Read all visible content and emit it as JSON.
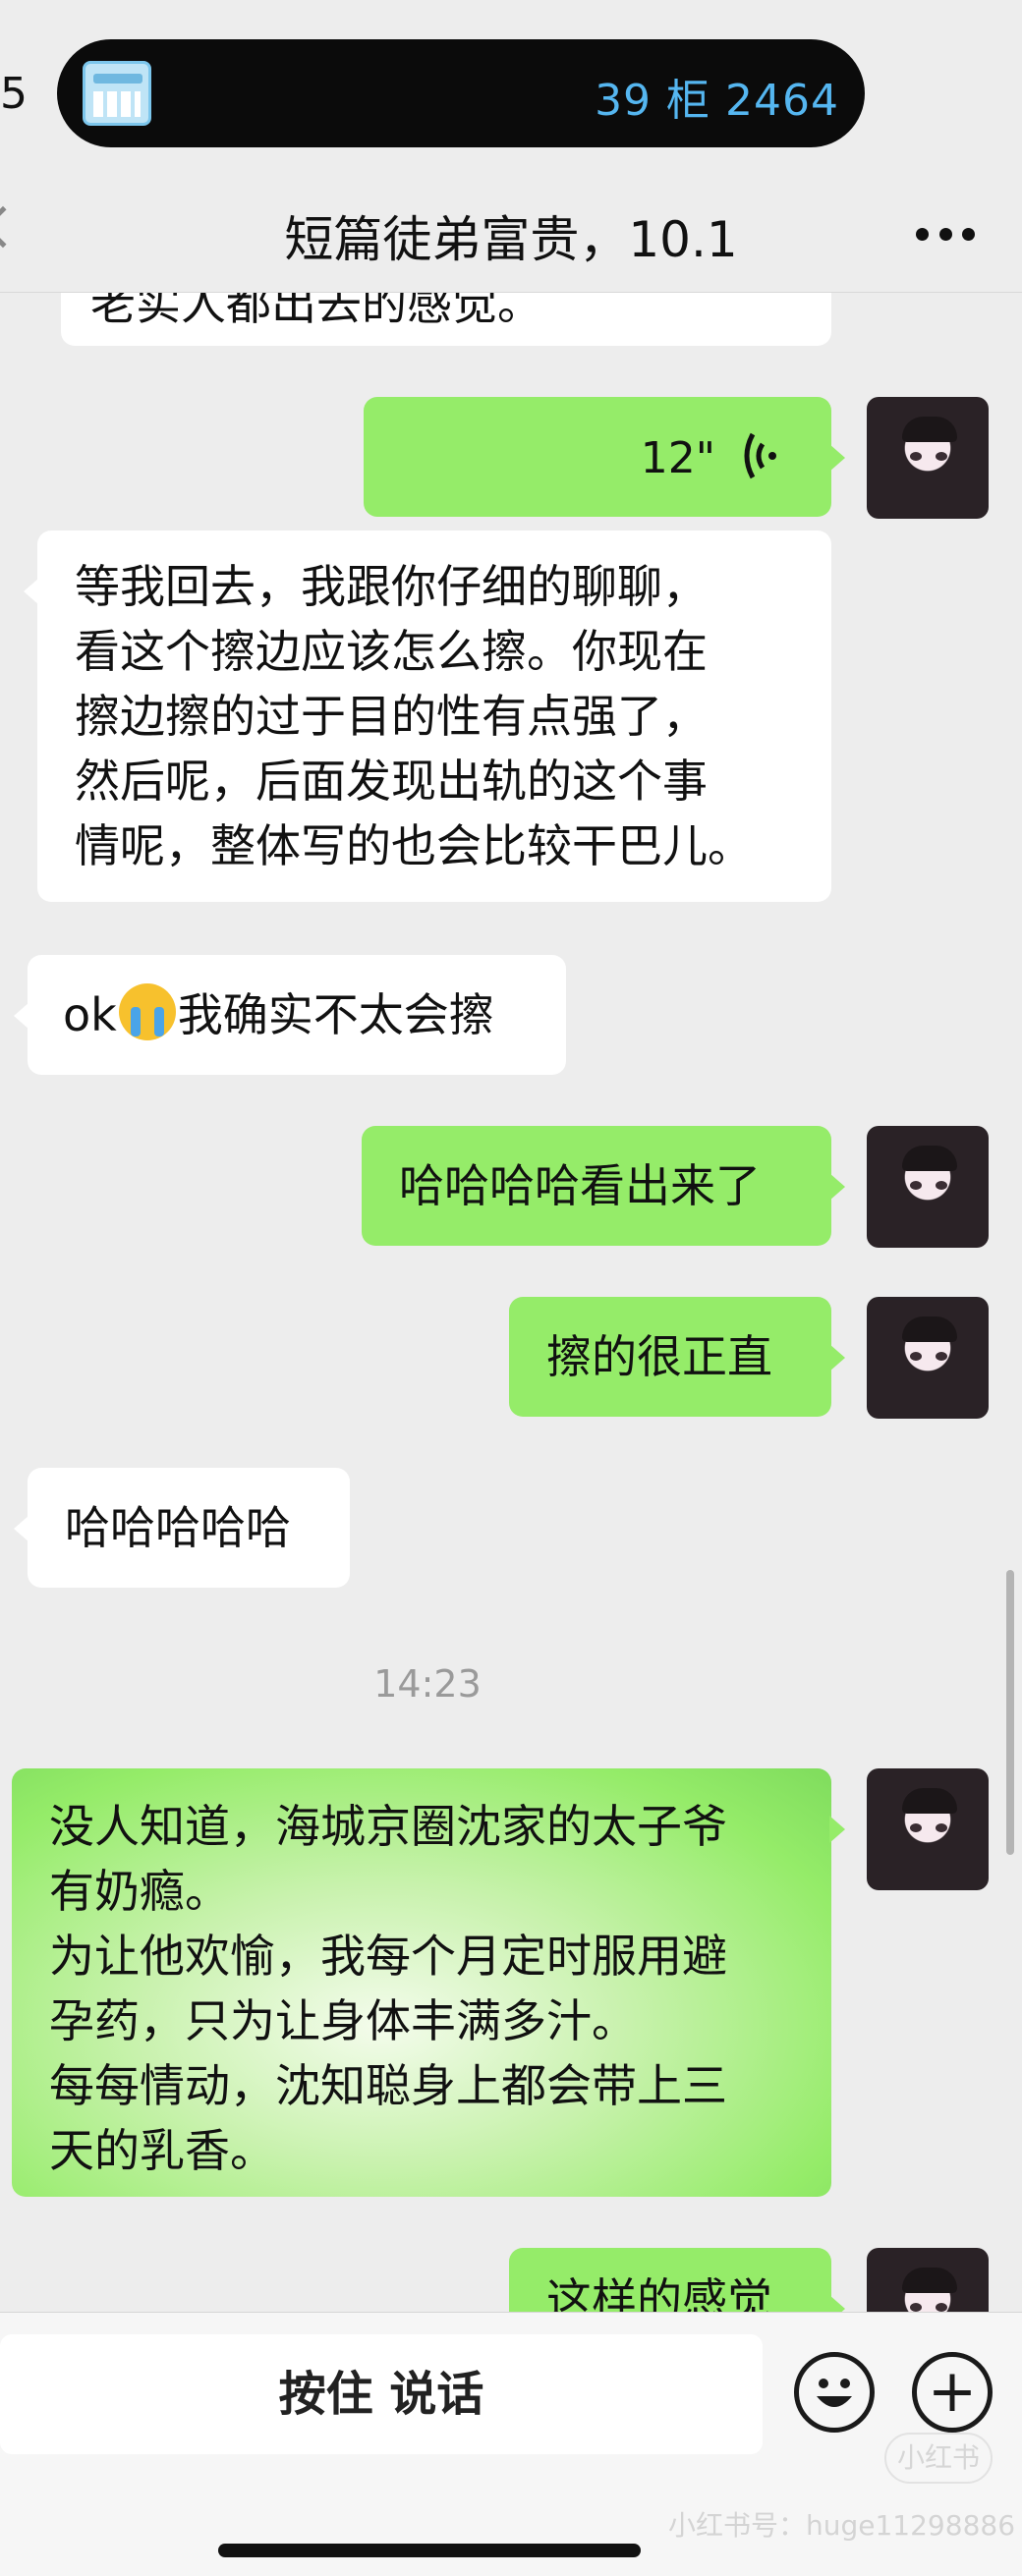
{
  "status": {
    "time_fragment": "5",
    "pill_text": "39 柜 2464",
    "pill_icon": "calendar-icon"
  },
  "header": {
    "title": "短篇徒弟富贵，10.1",
    "more_icon": "more-icon"
  },
  "messages": [
    {
      "side": "left",
      "text": "老实人都出去的感觉。"
    },
    {
      "side": "right",
      "type": "voice",
      "length": "12\"",
      "voice_icon": "🗣"
    },
    {
      "side": "left",
      "lines": [
        "等我回去，我跟你仔细的聊聊，",
        "看这个擦边应该怎么擦。你现在",
        "擦边擦的过于目的性有点强了，",
        "然后呢，后面发现出轨的这个事",
        "情呢，整体写的也会比较干巴儿。"
      ]
    },
    {
      "side": "left",
      "prefix": "ok",
      "suffix": "我确实不太会擦",
      "emoji": "crying-emoji"
    },
    {
      "side": "right",
      "text": "哈哈哈哈看出来了"
    },
    {
      "side": "right",
      "text": "擦的很正直"
    },
    {
      "side": "left",
      "text": "哈哈哈哈哈"
    },
    {
      "side": "right",
      "lines": [
        "没人知道，海城京圈沈家的太子爷",
        "有奶瘾。",
        "为让他欢愉，我每个月定时服用避",
        "孕药，只为让身体丰满多汁。",
        "每每情动，沈知聪身上都会带上三",
        "天的乳香。"
      ]
    },
    {
      "side": "right",
      "text": "这样的感觉"
    }
  ],
  "timestamp": "14:23",
  "input": {
    "hold_to_talk": "按住 说话",
    "emoji_button": "☺",
    "plus_button": "+"
  },
  "watermark": {
    "badge": "小红书",
    "text": "小红书号：huge11298886"
  }
}
